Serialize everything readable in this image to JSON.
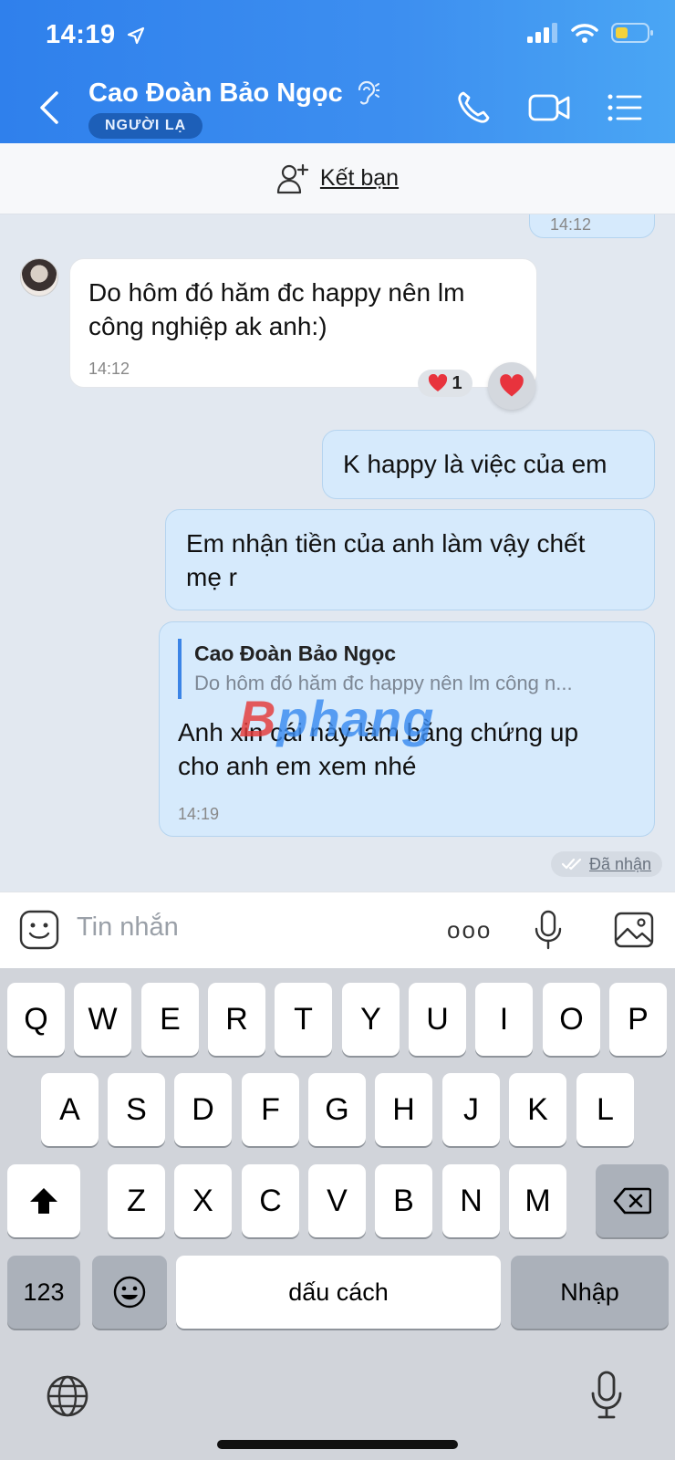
{
  "status_bar": {
    "time": "14:19"
  },
  "header": {
    "contact_name": "Cao Đoàn Bảo Ngọc",
    "badge": "NGƯỜI LẠ"
  },
  "friend_bar": {
    "label": "Kết bạn"
  },
  "messages": {
    "partial_time": "14:12",
    "m1": {
      "line1": "Do hôm đó hăm đc happy nên lm",
      "line2": "công nghiệp ak anh:)",
      "time": "14:12",
      "reaction_count": "1"
    },
    "m2": {
      "text": "K happy là việc của em"
    },
    "m3": {
      "line1": "Em nhận tiền của anh làm vậy chết",
      "line2": "mẹ r"
    },
    "m4": {
      "quote_name": "Cao Đoàn Bảo Ngọc",
      "quote_text": "Do hôm đó hăm đc happy nên lm công n...",
      "line1": "Anh xin cái này làm bằng chứng up",
      "line2": "cho anh em xem nhé",
      "time": "14:19"
    },
    "status": "Đã nhận",
    "watermark": "Bphang"
  },
  "input": {
    "placeholder": "Tin nhắn",
    "more": "ooo"
  },
  "keyboard": {
    "row1": [
      "Q",
      "W",
      "E",
      "R",
      "T",
      "Y",
      "U",
      "I",
      "O",
      "P"
    ],
    "row2": [
      "A",
      "S",
      "D",
      "F",
      "G",
      "H",
      "J",
      "K",
      "L"
    ],
    "row3": [
      "Z",
      "X",
      "C",
      "V",
      "B",
      "N",
      "M"
    ],
    "numbers": "123",
    "space": "dấu cách",
    "enter": "Nhập"
  },
  "colors": {
    "header_start": "#2f80ec",
    "header_end": "#4aa6f4",
    "bubble_out": "#d6eafc",
    "heart": "#e8333d"
  }
}
